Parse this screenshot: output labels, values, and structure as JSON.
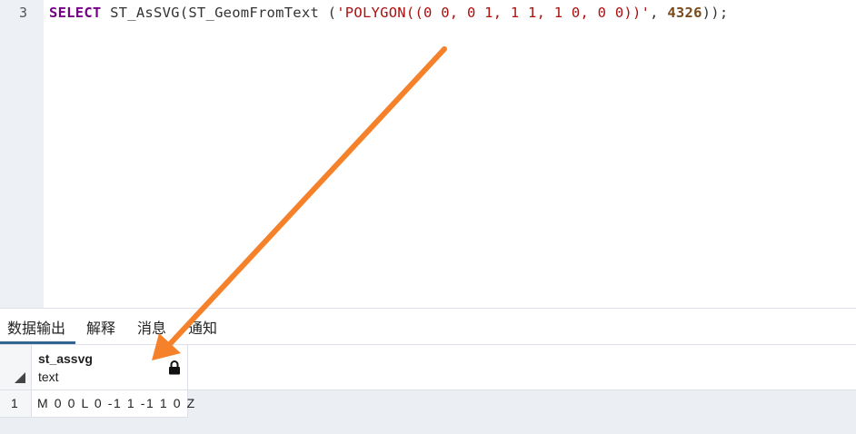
{
  "editor": {
    "line_number": "3",
    "code": {
      "kw_select": "SELECT",
      "fn_part": " ST_AsSVG(ST_GeomFromText (",
      "string_literal": "'POLYGON((0 0, 0 1, 1 1, 1 0, 0 0))'",
      "sep": ", ",
      "srid": "4326",
      "tail": "));"
    }
  },
  "results": {
    "tabs": [
      {
        "label": "数据输出",
        "active": true
      },
      {
        "label": "解释",
        "active": false
      },
      {
        "label": "消息",
        "active": false
      },
      {
        "label": "通知",
        "active": false
      }
    ],
    "columns": [
      {
        "name": "st_assvg",
        "type": "text",
        "icon": "lock-icon"
      }
    ],
    "rows": [
      {
        "row_number": "1",
        "values": [
          "M 0 0 L 0 -1 1 -1 1 0 Z"
        ]
      }
    ]
  },
  "annotation": {
    "arrow_color": "#f5822a",
    "icon": "arrow-annotation"
  }
}
